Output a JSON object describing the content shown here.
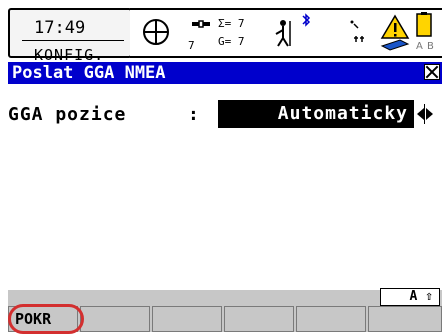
{
  "header": {
    "time": "17:49",
    "mode": "KONFIG.",
    "gps_count": "7",
    "sat_sigma": "Σ= 7",
    "sat_g": "G= 7"
  },
  "title": {
    "text": "Poslat GGA NMEA"
  },
  "form": {
    "label": "GGA pozice",
    "colon": ":",
    "value": "Automaticky"
  },
  "footer": {
    "shift_indicator": "A ⇧",
    "fkeys": [
      "POKR",
      "",
      "",
      "",
      "",
      ""
    ]
  },
  "colors": {
    "title_bg": "#0000cc",
    "footer_bg": "#c7c7c7",
    "highlight_ring": "#d32f2f"
  }
}
